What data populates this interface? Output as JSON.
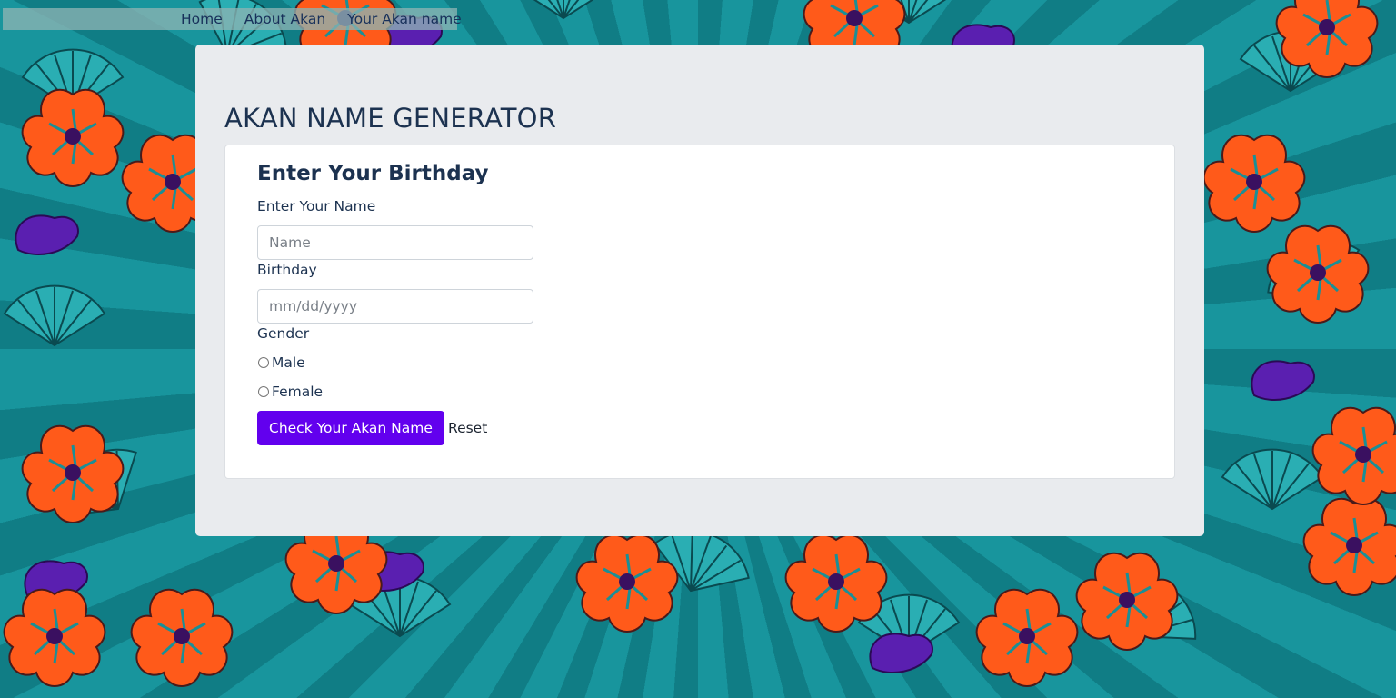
{
  "nav": {
    "items": [
      {
        "label": "Home"
      },
      {
        "label": "About Akan"
      },
      {
        "label": "Your Akan name"
      }
    ]
  },
  "page": {
    "title": "AKAN NAME GENERATOR"
  },
  "form": {
    "heading": "Enter Your Birthday",
    "name_label": "Enter Your Name",
    "name_placeholder": "Name",
    "name_value": "",
    "birthday_label": "Birthday",
    "birthday_placeholder": "mm/dd/yyyy",
    "birthday_value": "",
    "gender_label": "Gender",
    "gender_options": [
      {
        "label": "Male",
        "checked": false
      },
      {
        "label": "Female",
        "checked": false
      }
    ],
    "submit_label": "Check Your Akan Name",
    "reset_label": "Reset"
  },
  "colors": {
    "accent": "#6200ee",
    "heading": "#1c3250",
    "panel": "#e9ebee"
  },
  "background": {
    "pattern": "african-wax-print-flowers"
  }
}
